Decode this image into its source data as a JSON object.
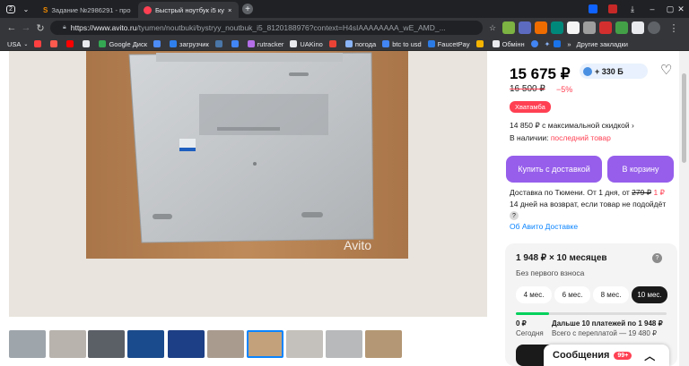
{
  "browser": {
    "tabs": [
      {
        "label": "Задание №2986291 - про"
      },
      {
        "label": "Быстрый ноутбук i5 ку"
      }
    ],
    "tab_counter": "2",
    "new_tab_label": "+",
    "url_host": "https://www.avito.ru",
    "url_path": "/tyumen/noutbuki/bystryy_noutbuk_i5_8120188976?context=H4sIAAAAAAAA_wE_AMD_..."
  },
  "bookmarks": [
    {
      "label": "USA",
      "color": "#9aa0a6"
    },
    {
      "label": "",
      "color": "#ff4040"
    },
    {
      "label": "",
      "color": "#ff5a4e"
    },
    {
      "label": "",
      "color": "#ff0000"
    },
    {
      "label": "",
      "color": "#e8eaed"
    },
    {
      "label": "Google Диск",
      "color": "#34a853"
    },
    {
      "label": "",
      "color": "#4d8bf5"
    },
    {
      "label": "загрузчик",
      "color": "#2f80ed"
    },
    {
      "label": "",
      "color": "#4a76a8"
    },
    {
      "label": "",
      "color": "#4285f4"
    },
    {
      "label": "rutracker",
      "color": "#b46ee8"
    },
    {
      "label": "UAKino",
      "color": "#1a1a1a"
    },
    {
      "label": "",
      "color": "#ea4335"
    },
    {
      "label": "погода",
      "color": "#8ab4f8"
    },
    {
      "label": "btc to usd",
      "color": "#4285f4"
    },
    {
      "label": "FaucetPay",
      "color": "#2c7be5"
    },
    {
      "label": "",
      "color": "#f4b400"
    },
    {
      "label": "Обмінн",
      "color": "#e8eaed"
    }
  ],
  "bookmarks_other": "Другие закладки",
  "listing": {
    "price": "15 675 ₽",
    "bonus": "+ 330 Б",
    "old_price": "16 500 ₽",
    "discount": "−5%",
    "badge": "Хватамба",
    "max_discount": "14 850 ₽ с максимальной скидкой",
    "stock_label": "В наличии:",
    "stock_value": "последний товар",
    "buy_button": "Купить с доставкой",
    "cart_button": "В корзину",
    "delivery_text": "Доставка по Тюмени. От 1 дня, от",
    "delivery_old": "279 ₽",
    "delivery_new": "1 ₽",
    "returns_text": "14 дней на возврат, если товар не подойдёт",
    "help_icon": "?",
    "avito_delivery_link": "Об Авито Доставке",
    "watermark": "Avito"
  },
  "installment": {
    "title": "1 948 ₽ × 10 месяцев",
    "help_icon": "?",
    "subtitle": "Без первого взноса",
    "terms": [
      "4 мес.",
      "6 мес.",
      "8 мес.",
      "10 мес."
    ],
    "selected_term": "10 мес.",
    "today_amount": "0 ₽",
    "today_label": "Сегодня",
    "next_label": "Дальше 10 платежей по 1 948 ₽",
    "overpay_label": "Всего с переплатой — 19 480 ₽",
    "progress_fraction": 0.22
  },
  "chat": {
    "label": "Сообщения",
    "badge": "99+"
  },
  "thumbnails_count_label": "",
  "colors": {
    "accent": "#965eeb",
    "sale": "#ff4053",
    "link": "#0a84ff",
    "progress": "#02d15c"
  }
}
